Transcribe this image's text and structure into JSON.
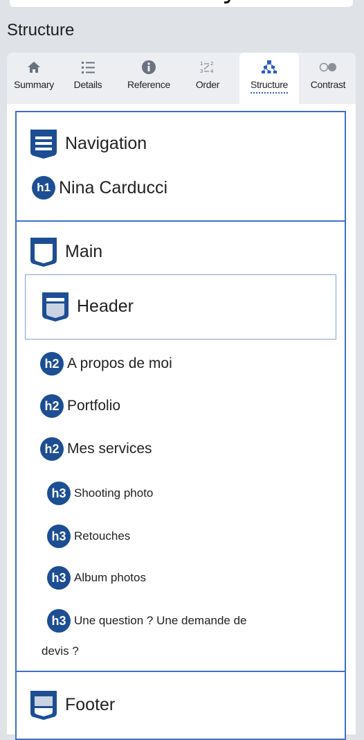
{
  "panel": {
    "title": "Structure"
  },
  "tabs": [
    {
      "label": "Summary",
      "icon": "home-icon",
      "active": false
    },
    {
      "label": "Details",
      "icon": "list-icon",
      "active": false
    },
    {
      "label": "Reference",
      "icon": "info-icon",
      "active": false
    },
    {
      "label": "Order",
      "icon": "order-icon",
      "active": false
    },
    {
      "label": "Structure",
      "icon": "structure-tree-icon",
      "active": true
    },
    {
      "label": "Contrast",
      "icon": "contrast-icon",
      "active": false
    }
  ],
  "navigation": {
    "label": "Navigation",
    "heading": {
      "level": "h1",
      "text": "Nina Carducci"
    }
  },
  "main": {
    "label": "Main",
    "header": {
      "label": "Header"
    },
    "headings": [
      {
        "level": "h2",
        "text": "A propos de moi"
      },
      {
        "level": "h2",
        "text": "Portfolio"
      },
      {
        "level": "h2",
        "text": "Mes services"
      },
      {
        "level": "h3",
        "text": "Shooting photo"
      },
      {
        "level": "h3",
        "text": "Retouches"
      },
      {
        "level": "h3",
        "text": "Album photos"
      },
      {
        "level": "h3",
        "text": "Une question ? Une demande de",
        "text_cont": "devis ?"
      }
    ]
  },
  "footer": {
    "label": "Footer"
  },
  "colors": {
    "accent": "#3f6fc6",
    "badge": "#1d4e94",
    "icon_dark": "#1d4e94"
  }
}
